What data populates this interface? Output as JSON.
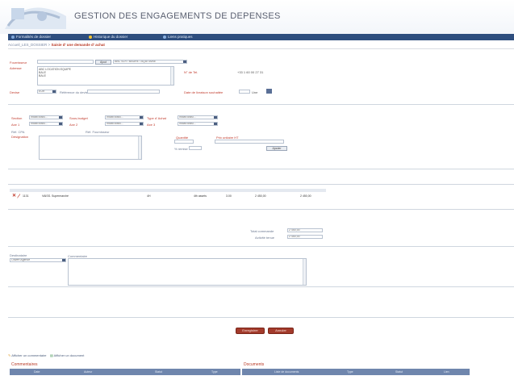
{
  "app": {
    "title": "GESTION DES ENGAGEMENTS DE DEPENSES"
  },
  "nav": {
    "items": [
      {
        "label": "Formalités de dossier",
        "color": "#7fa6d8"
      },
      {
        "label": "Historique du dossier",
        "color": "#f2c230"
      },
      {
        "label": "Liens pratiques",
        "color": "#8ab0e0"
      }
    ]
  },
  "breadcrumb": {
    "parent": "Accueil_LES_DOSSIER",
    "sep": ">",
    "current": "Saisie d' une demande d' achat"
  },
  "form": {
    "fournisseur_label": "Fournisseur",
    "fournisseur_value": "",
    "search_button": "Ajout",
    "fournisseur_code_select": "ABC SLR / BAURE / AQUITAINE",
    "adresse_label": "Adresse",
    "adresse_lines": [
      "ABC LOCATION EQUIPE",
      "BALE",
      "BALE"
    ],
    "tel_label": "N° de Tel.",
    "tel_value": "+33 1 60 00 27 31",
    "devise_label": "Devise",
    "devise_value": "EUR",
    "ref_devis_label": "Référence du devis",
    "ref_devis_value": "",
    "date_label": "Date de livraison souhaitée",
    "date_value": "",
    "date_unit": "Une"
  },
  "imputation": {
    "section_label": "Section",
    "section_value": "Indiat dossi...",
    "sous_budget_label": "Sous-budget",
    "sous_budget_value": "Indiat dossi...",
    "type_label": "Type d' Achat",
    "type_value": "Indiat dossi...",
    "axe1_label": "Axe 1",
    "axe1_value": "Indiat dossi...",
    "axe2_label": "Axe 2",
    "axe2_value": "Indiat dossi...",
    "axe3_label": "Axe 3",
    "axe3_value": "Indiat dossi...",
    "ref_label": "Réf. CPA",
    "ref_fournisseur_label": "Réf. Fournisseur",
    "designation_label": "Désignation",
    "quantite_label": "Quantité",
    "prix_label": "Prix unitaire HT",
    "remise_label": "% remise",
    "ajouter_button": "Ajouter"
  },
  "table": {
    "rows": [
      {
        "code": "1131",
        "label": "VAISS. Supermarché",
        "qty": "4H",
        "unit": "4th assets",
        "pu": "3.00",
        "total": "2 450,00",
        "total_ttc": "2 450,00"
      }
    ]
  },
  "totals": {
    "ht_label": "Total commande",
    "ht_value": "2 450,00",
    "ttc_label": "Activité tenue",
    "ttc_value": "2 450,00"
  },
  "remarks": {
    "destinataire_label": "Destinataire",
    "destinataire_value": "Ouvert Agence",
    "commentaire_label": "Commentaire"
  },
  "actions": {
    "save_label": "Enregistrer",
    "cancel_label": "Annuler"
  },
  "footer": {
    "link_comments": "Afficher un commentaire",
    "link_docs": "Afficher un document",
    "comments_title": "Commentaires",
    "comments_cols": [
      "Date",
      "Auteur",
      "Statut",
      "Type"
    ],
    "docs_title": "Documents",
    "docs_cols": [
      "Liste de documents",
      "Type",
      "Statut",
      "Lien"
    ]
  }
}
